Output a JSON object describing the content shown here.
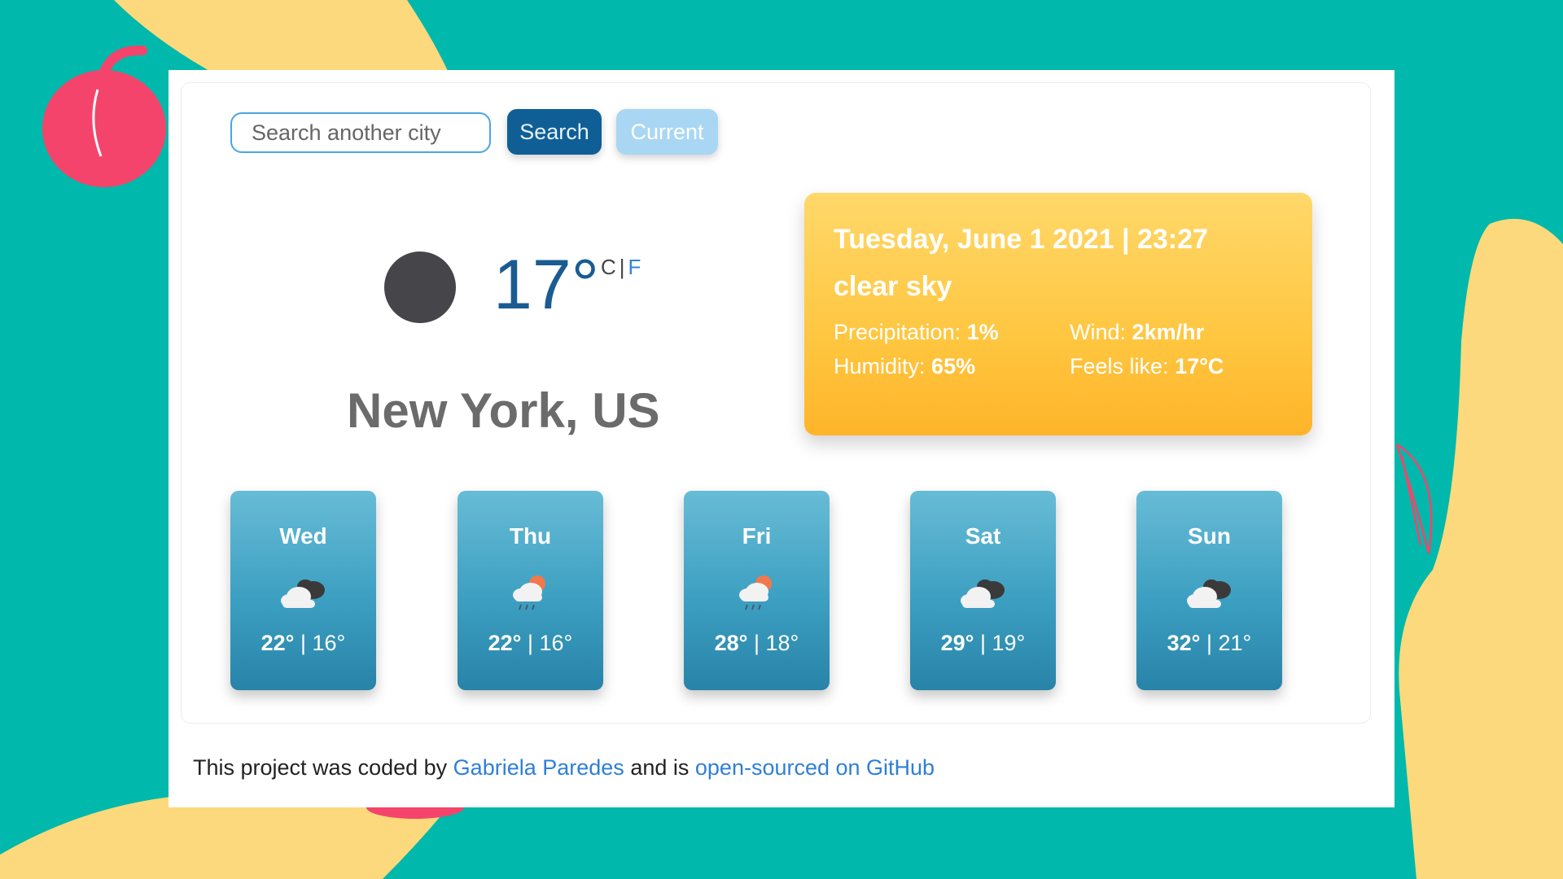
{
  "search": {
    "placeholder": "Search another city",
    "search_label": "Search",
    "current_label": "Current"
  },
  "current": {
    "temperature": "17°",
    "unit_c": "C",
    "unit_sep": "|",
    "unit_f": "F",
    "city": "New York, US"
  },
  "details": {
    "date": "Tuesday, June 1 2021 | 23:27",
    "description": "clear sky",
    "precipitation_label": "Precipitation:",
    "precipitation_value": "1%",
    "wind_label": "Wind:",
    "wind_value": "2km/hr",
    "humidity_label": "Humidity:",
    "humidity_value": "65%",
    "feels_label": "Feels like:",
    "feels_value": "17°C"
  },
  "forecast": [
    {
      "day": "Wed",
      "hi": "22°",
      "sep": "|",
      "lo": "16°",
      "icon": "cloudy-icon"
    },
    {
      "day": "Thu",
      "hi": "22°",
      "sep": "|",
      "lo": "16°",
      "icon": "rain-sun-icon"
    },
    {
      "day": "Fri",
      "hi": "28°",
      "sep": "|",
      "lo": "18°",
      "icon": "rain-sun-icon"
    },
    {
      "day": "Sat",
      "hi": "29°",
      "sep": "|",
      "lo": "19°",
      "icon": "cloudy-icon"
    },
    {
      "day": "Sun",
      "hi": "32°",
      "sep": "|",
      "lo": "21°",
      "icon": "cloudy-icon"
    }
  ],
  "footer": {
    "prefix": "This project was coded by",
    "author": "Gabriela Paredes",
    "middle": "and is",
    "repo_link": "open-sourced on GitHub"
  },
  "colors": {
    "background": "#00b8ab",
    "blob": "#fcd97c",
    "apple": "#f5446b",
    "info_box": "#ffc640",
    "forecast_card": "#3c9fc1",
    "search_button": "#0f5f96",
    "current_button": "#a9d7f3",
    "link": "#2f7fd6"
  }
}
